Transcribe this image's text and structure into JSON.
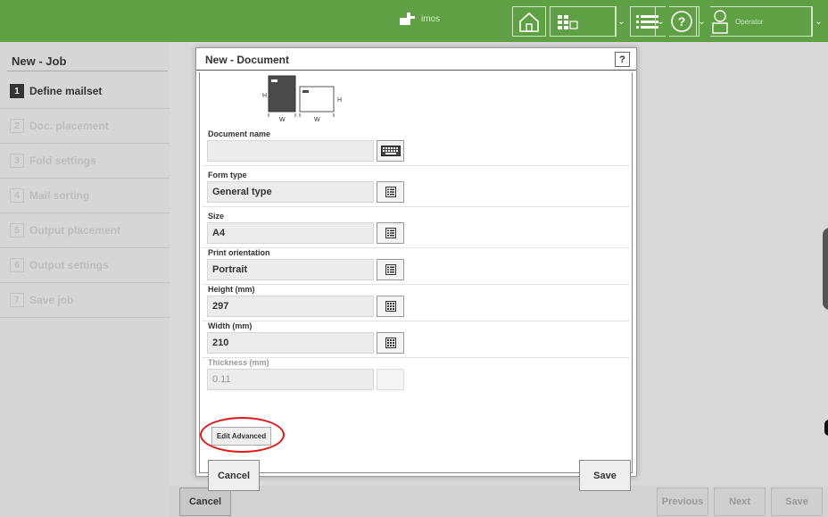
{
  "topbar": {
    "logo_text": "imos",
    "user_label": "Operator",
    "icons": [
      "home-icon",
      "grid-icon",
      "list-icon",
      "help-icon",
      "user-icon"
    ]
  },
  "nav": {
    "title": "New - Job",
    "steps": [
      {
        "num": "1",
        "label": "Define mailset",
        "active": true
      },
      {
        "num": "2",
        "label": "Doc. placement",
        "active": false
      },
      {
        "num": "3",
        "label": "Fold settings",
        "active": false
      },
      {
        "num": "4",
        "label": "Mail sorting",
        "active": false
      },
      {
        "num": "5",
        "label": "Output placement",
        "active": false
      },
      {
        "num": "6",
        "label": "Output settings",
        "active": false
      },
      {
        "num": "7",
        "label": "Save job",
        "active": false
      }
    ]
  },
  "bottom": {
    "cancel": "Cancel",
    "previous": "Previous",
    "next": "Next",
    "save": "Save"
  },
  "modal": {
    "title": "New - Document",
    "help": "?",
    "diagram": {
      "h": "H",
      "w": "W"
    },
    "fields": {
      "document_name": {
        "label": "Document name",
        "value": ""
      },
      "form_type": {
        "label": "Form type",
        "value": "General type"
      },
      "size": {
        "label": "Size",
        "value": "A4"
      },
      "print_orientation": {
        "label": "Print orientation",
        "value": "Portrait"
      },
      "height": {
        "label": "Height (mm)",
        "value": "297"
      },
      "width": {
        "label": "Width (mm)",
        "value": "210"
      },
      "thickness": {
        "label": "Thickness (mm)",
        "value": "0.11"
      }
    },
    "edit_advanced": "Edit Advanced",
    "cancel": "Cancel",
    "save": "Save"
  },
  "colors": {
    "topbar": "#5fa044",
    "highlight": "#e01818"
  }
}
